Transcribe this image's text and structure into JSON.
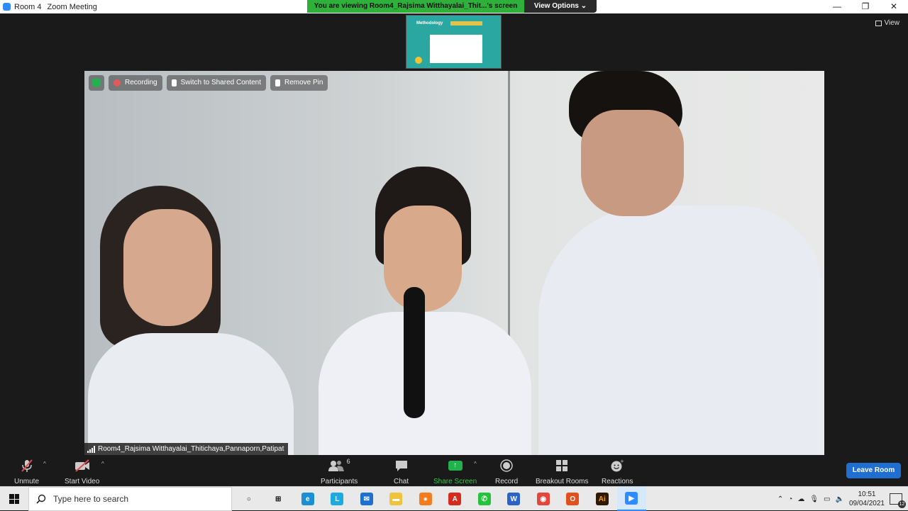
{
  "window": {
    "title": "Room 4",
    "app_name": "Zoom Meeting",
    "controls": [
      "—",
      "❐",
      "✕"
    ]
  },
  "banner": {
    "viewing": "You are viewing Room4_Rajsima Witthayalai_Thit...'s screen",
    "view_options": "View Options ⌄"
  },
  "view_button": {
    "label": "View"
  },
  "shared_thumb": {
    "title": "Methodology"
  },
  "video_toolbar": {
    "recording": "Recording",
    "switch": "Switch to Shared Content",
    "remove_pin": "Remove Pin"
  },
  "participant_name": "Room4_Rajsima Witthayalai_Thitichaya,Pannaporn,Patipat",
  "controls": {
    "unmute": "Unmute",
    "start_video": "Start Video",
    "participants": "Participants",
    "participants_count": "6",
    "chat": "Chat",
    "share_screen": "Share Screen",
    "record": "Record",
    "breakout_rooms": "Breakout Rooms",
    "reactions": "Reactions",
    "leave": "Leave Room"
  },
  "taskbar": {
    "search_placeholder": "Type here to search",
    "apps": [
      {
        "name": "cortana-icon",
        "glyph": "○",
        "color": "#e9e9e9",
        "fg": "#111"
      },
      {
        "name": "task-view-icon",
        "glyph": "⊞",
        "color": "#e9e9e9",
        "fg": "#111"
      },
      {
        "name": "edge-icon",
        "glyph": "e",
        "color": "#1a8fd4",
        "fg": "#fff"
      },
      {
        "name": "l-app-icon",
        "glyph": "L",
        "color": "#1faadf",
        "fg": "#fff"
      },
      {
        "name": "mail-icon",
        "glyph": "✉",
        "color": "#1e6fcf",
        "fg": "#fff"
      },
      {
        "name": "file-explorer-icon",
        "glyph": "▬",
        "color": "#f0c33c",
        "fg": "#fff"
      },
      {
        "name": "firefox-icon",
        "glyph": "●",
        "color": "#f37c1e",
        "fg": "#fff"
      },
      {
        "name": "acrobat-icon",
        "glyph": "A",
        "color": "#d52b1e",
        "fg": "#fff"
      },
      {
        "name": "whatsapp-icon",
        "glyph": "✆",
        "color": "#25c23c",
        "fg": "#fff"
      },
      {
        "name": "word-icon",
        "glyph": "W",
        "color": "#2b63c6",
        "fg": "#fff"
      },
      {
        "name": "chrome-icon",
        "glyph": "◉",
        "color": "#e4463a",
        "fg": "#fff"
      },
      {
        "name": "office-icon",
        "glyph": "O",
        "color": "#e2501e",
        "fg": "#fff"
      },
      {
        "name": "illustrator-icon",
        "glyph": "Ai",
        "color": "#2d1a00",
        "fg": "#ff9a00"
      },
      {
        "name": "zoom-icon",
        "glyph": "▶",
        "color": "#2d8cff",
        "fg": "#fff",
        "active": true
      }
    ],
    "time": "10:51",
    "date": "09/04/2021",
    "notification_count": "12"
  }
}
